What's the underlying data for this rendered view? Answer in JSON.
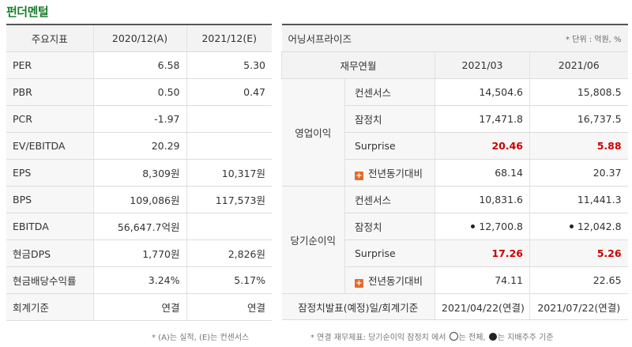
{
  "title": "펀더멘털",
  "left": {
    "headers": [
      "주요지표",
      "2020/12(A)",
      "2021/12(E)"
    ],
    "rows": [
      {
        "label": "PER",
        "a": "6.58",
        "e": "5.30"
      },
      {
        "label": "PBR",
        "a": "0.50",
        "e": "0.47"
      },
      {
        "label": "PCR",
        "a": "-1.97",
        "e": ""
      },
      {
        "label": "EV/EBITDA",
        "a": "20.29",
        "e": ""
      },
      {
        "label": "EPS",
        "a": "8,309원",
        "e": "10,317원"
      },
      {
        "label": "BPS",
        "a": "109,086원",
        "e": "117,573원"
      },
      {
        "label": "EBITDA",
        "a": "56,647.7억원",
        "e": ""
      },
      {
        "label": "현금DPS",
        "a": "1,770원",
        "e": "2,826원"
      },
      {
        "label": "현금배당수익률",
        "a": "3.24%",
        "e": "5.17%"
      },
      {
        "label": "회계기준",
        "a": "연결",
        "e": "연결"
      }
    ],
    "footnote": "* (A)는 실적, (E)는 컨센서스"
  },
  "right": {
    "title": "어닝서프라이즈",
    "unit": "* 단위 : 억원, %",
    "subheaders": [
      "재무연월",
      "2021/03",
      "2021/06"
    ],
    "op": {
      "label": "영업이익",
      "consensus": {
        "label": "컨센서스",
        "v1": "14,504.6",
        "v2": "15,808.5"
      },
      "provisional": {
        "label": "잠정치",
        "v1": "17,471.8",
        "v2": "16,737.5"
      },
      "surprise": {
        "label": "Surprise",
        "v1": "20.46",
        "v2": "5.88"
      },
      "yoy": {
        "label": "전년동기대비",
        "v1": "68.14",
        "v2": "20.37"
      }
    },
    "net": {
      "label": "당기순이익",
      "consensus": {
        "label": "컨센서스",
        "v1": "10,831.6",
        "v2": "11,441.3"
      },
      "provisional": {
        "label": "잠정치",
        "v1": "12,700.8",
        "v2": "12,042.8"
      },
      "surprise": {
        "label": "Surprise",
        "v1": "17.26",
        "v2": "5.26"
      },
      "yoy": {
        "label": "전년동기대비",
        "v1": "74.11",
        "v2": "22.65"
      }
    },
    "release": {
      "label": "잠정치발표(예정)일/회계기준",
      "v1": "2021/04/22(연결)",
      "v2": "2021/07/22(연결)"
    },
    "footnote_a": "* 연결 재무제표: 당기순이익 잠정치 에서",
    "footnote_b": "는 전체,",
    "footnote_c": "는 지배주주 기준"
  }
}
